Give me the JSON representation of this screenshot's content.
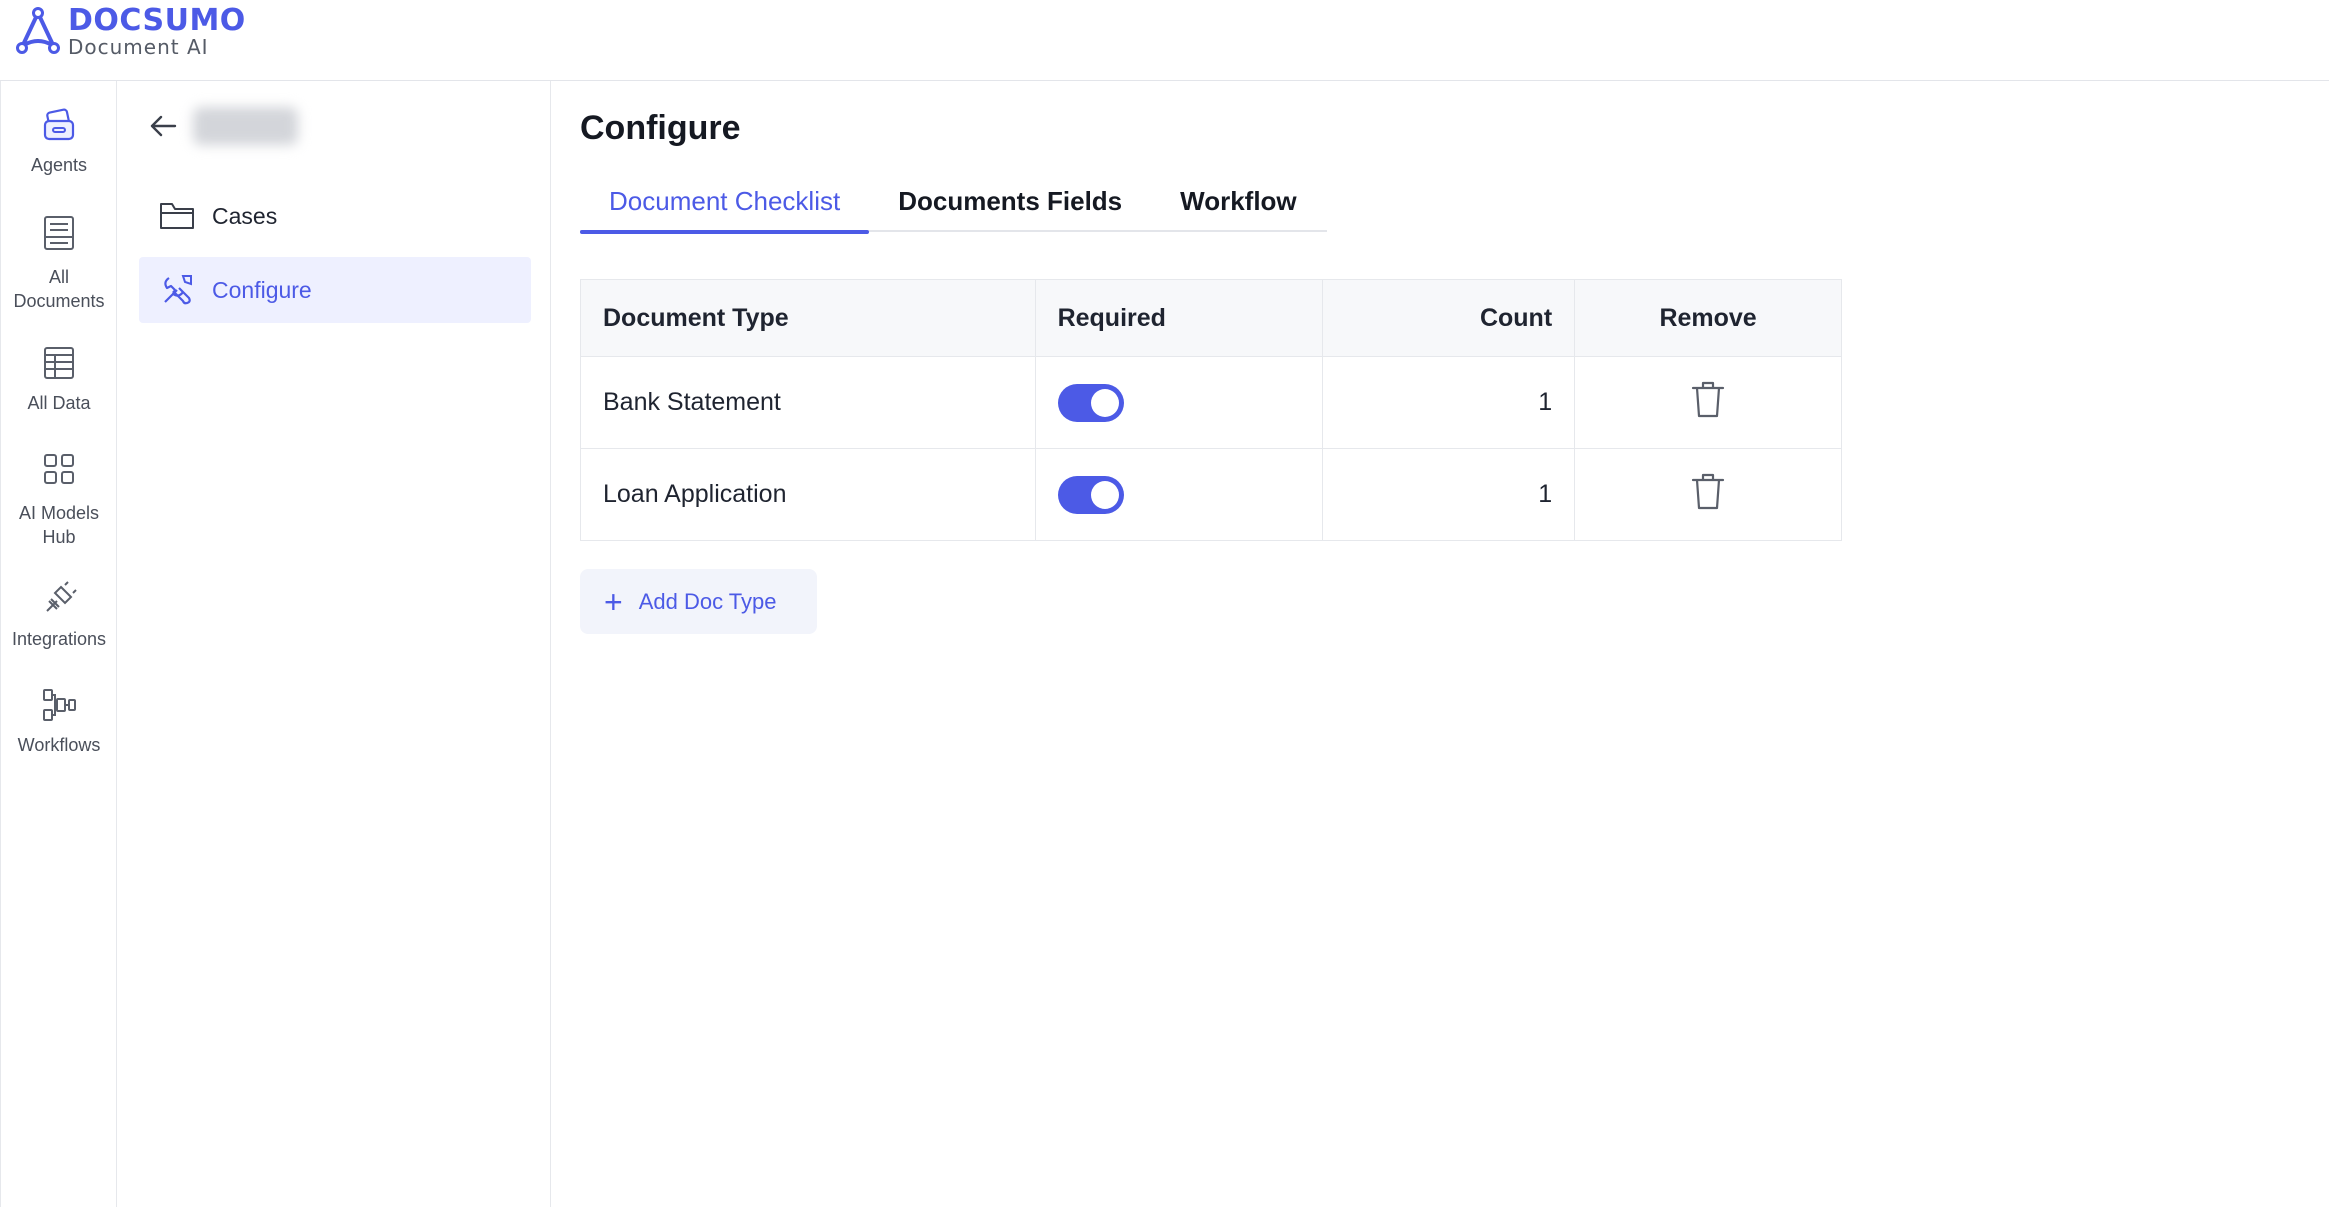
{
  "brand": {
    "name": "DOCSUMO",
    "subtitle": "Document AI",
    "accent": "#4c5ae6"
  },
  "rail": {
    "items": [
      {
        "label": "Agents",
        "icon": "agents-icon"
      },
      {
        "label": "All Documents",
        "icon": "documents-icon"
      },
      {
        "label": "All Data",
        "icon": "table-icon"
      },
      {
        "label": "AI Models Hub",
        "icon": "grid-icon"
      },
      {
        "label": "Integrations",
        "icon": "plug-icon"
      },
      {
        "label": "Workflows",
        "icon": "workflow-icon"
      }
    ]
  },
  "subside": {
    "back_icon": "arrow-left-icon",
    "items": [
      {
        "label": "Cases",
        "icon": "folder-icon",
        "active": false
      },
      {
        "label": "Configure",
        "icon": "tools-icon",
        "active": true
      }
    ]
  },
  "main": {
    "title": "Configure",
    "tabs": [
      {
        "label": "Document Checklist",
        "active": true
      },
      {
        "label": "Documents Fields",
        "active": false
      },
      {
        "label": "Workflow",
        "active": false
      }
    ],
    "table": {
      "headers": [
        "Document Type",
        "Required",
        "Count",
        "Remove"
      ],
      "rows": [
        {
          "type": "Bank Statement",
          "required": true,
          "count": "1"
        },
        {
          "type": "Loan Application",
          "required": true,
          "count": "1"
        }
      ]
    },
    "add_button": "Add Doc Type"
  }
}
